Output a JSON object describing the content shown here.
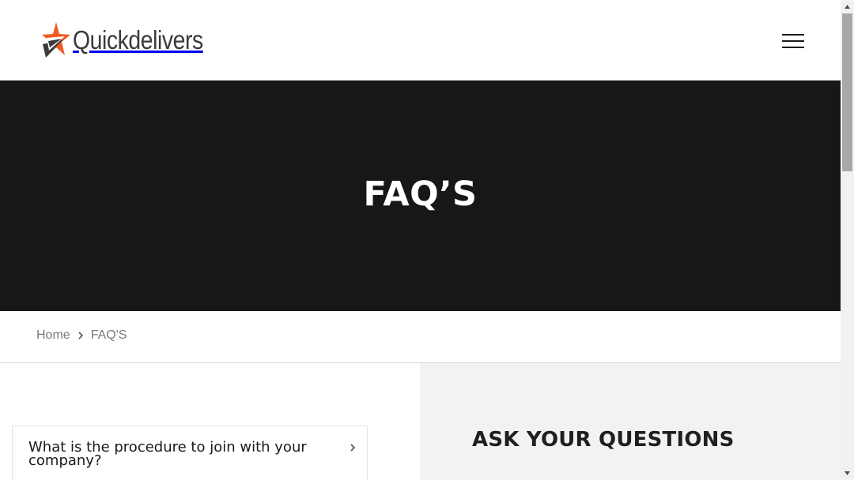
{
  "brand": {
    "name": "Quickdelivers",
    "colors": {
      "star_orange": "#f15a22",
      "star_dark": "#3a3a3a"
    }
  },
  "header": {
    "menu_icon": "hamburger-menu-icon"
  },
  "hero": {
    "title": "FAQ’S",
    "background": "#171717"
  },
  "breadcrumb": {
    "home": "Home",
    "current": "FAQ'S",
    "separator_icon": "chevron-right-icon"
  },
  "faq": {
    "items": [
      {
        "question": "What is the procedure to join with your company?",
        "icon": "chevron-right-icon"
      }
    ]
  },
  "ask": {
    "title": "ASK YOUR QUESTIONS"
  }
}
